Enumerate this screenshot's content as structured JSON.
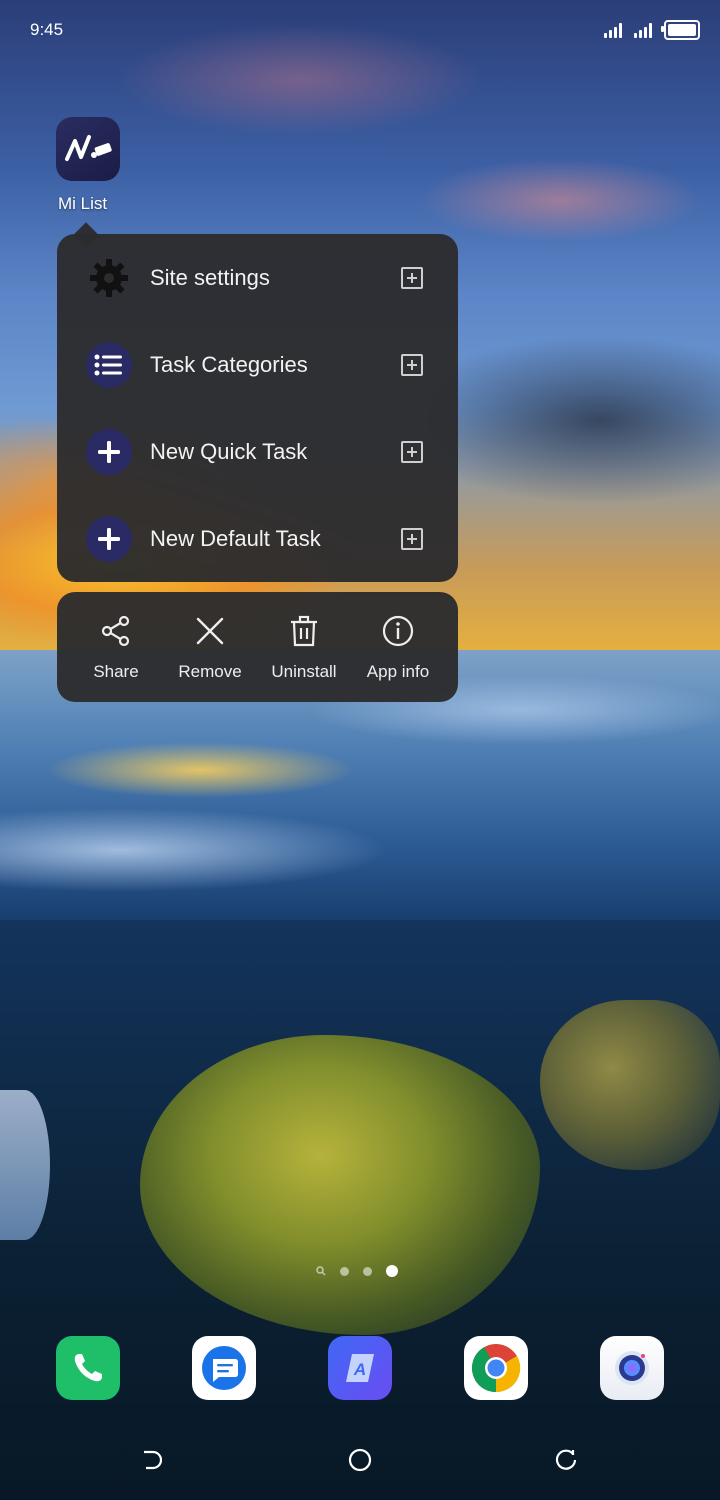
{
  "status_bar": {
    "time": "9:45",
    "icons": [
      "signal-icon",
      "signal-icon",
      "battery-icon"
    ]
  },
  "app": {
    "name": "Mi List",
    "icon": "mi-list-logo"
  },
  "shortcut_menu": {
    "items": [
      {
        "label": "Site settings",
        "icon": "gear-icon"
      },
      {
        "label": "Task Categories",
        "icon": "list-icon"
      },
      {
        "label": "New Quick Task",
        "icon": "plus-icon"
      },
      {
        "label": "New Default Task",
        "icon": "plus-icon"
      }
    ],
    "pin_icon": "add-to-home-icon"
  },
  "actions": [
    {
      "label": "Share",
      "icon": "share-icon"
    },
    {
      "label": "Remove",
      "icon": "close-icon"
    },
    {
      "label": "Uninstall",
      "icon": "trash-icon"
    },
    {
      "label": "App info",
      "icon": "info-icon"
    }
  ],
  "page_indicator": {
    "pages": 4,
    "current": 4
  },
  "dock": [
    {
      "app": "Phone",
      "icon": "phone-icon"
    },
    {
      "app": "Messages",
      "icon": "messages-icon"
    },
    {
      "app": "Translate",
      "icon": "translate-icon"
    },
    {
      "app": "Chrome",
      "icon": "chrome-icon"
    },
    {
      "app": "Camera",
      "icon": "camera-icon"
    }
  ],
  "navigation": [
    "back-icon",
    "home-icon",
    "recents-icon"
  ],
  "colors": {
    "menu_bg": "#2c2c2e",
    "shortcut_circle": "#2a2a64",
    "phone_green": "#1fbf6a",
    "messages_blue": "#1a73e8"
  }
}
